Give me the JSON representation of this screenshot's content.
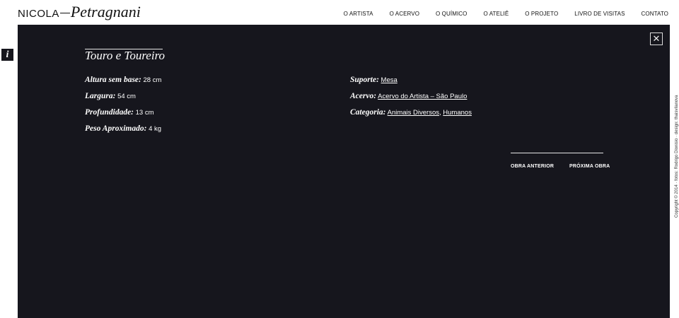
{
  "header": {
    "logo_first": "NICOLA",
    "logo_last": "Petragnani",
    "nav": [
      "O ARTISTA",
      "O ACERVO",
      "O QUÍMICO",
      "O ATELIÊ",
      "O PROJETO",
      "LIVRO DE VISITAS",
      "CONTATO"
    ]
  },
  "sidebar": {
    "info_icon": "i"
  },
  "panel": {
    "close_icon": "✕",
    "title": "Touro e Toureiro",
    "left": {
      "altura_label": "Altura sem base:",
      "altura_value": "28 cm",
      "largura_label": "Largura:",
      "largura_value": "54 cm",
      "profundidade_label": "Profundidade:",
      "profundidade_value": "13 cm",
      "peso_label": "Peso Aproximado:",
      "peso_value": "4 kg"
    },
    "right": {
      "suporte_label": "Suporte:",
      "suporte_value": "Mesa",
      "acervo_label": "Acervo:",
      "acervo_value": "Acervo do Artista – São Paulo",
      "categoria_label": "Categoria:",
      "categoria_values": [
        "Animais Diversos",
        "Humanos"
      ],
      "categoria_sep": ","
    },
    "prev_label": "OBRA ANTERIOR",
    "next_label": "PRÓXIMA OBRA"
  },
  "credits": "Copyright © 2014 · fotos: Rodrigo Dionisio · design: thaisvilanova",
  "colors": {
    "panel_bg": "#16161d",
    "text": "#ffffff",
    "page_bg": "#ffffff"
  }
}
